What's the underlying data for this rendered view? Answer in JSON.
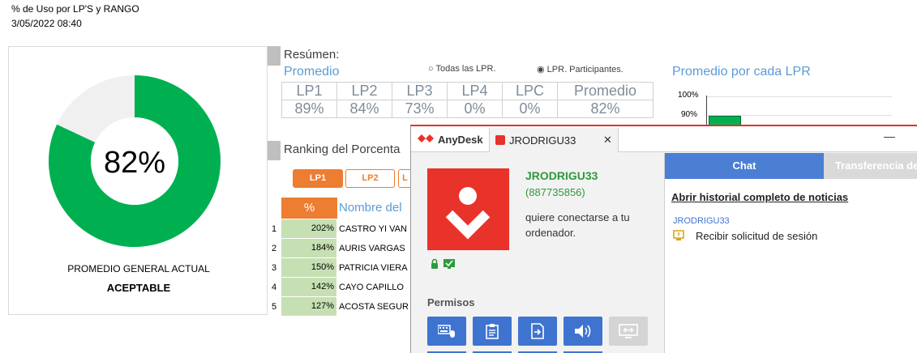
{
  "header": {
    "title": "% de Uso por LP'S y RANGO",
    "date": "3/05/2022 08:40"
  },
  "gauge": {
    "value_pct": 82,
    "value_label": "82%",
    "label": "PROMEDIO GENERAL ACTUAL",
    "status": "ACEPTABLE",
    "colors": {
      "fill": "#00b050",
      "track": "#f0f0f0",
      "border": "#1a7a3a"
    }
  },
  "resumen": {
    "title": "Resúmen:",
    "subtitle": "Promedio",
    "radio_all": "Todas las LPR.",
    "radio_part": "LPR. Participantes.",
    "radio_selected": "participantes",
    "headers": [
      "LP1",
      "LP2",
      "LP3",
      "LP4",
      "LPC",
      "Promedio"
    ],
    "values": [
      "89%",
      "84%",
      "73%",
      "0%",
      "0%",
      "82%"
    ]
  },
  "ranking": {
    "title": "Ranking del Porcenta",
    "buttons": [
      "LP1",
      "LP2",
      "L"
    ],
    "active_button": "LP1",
    "col_pct": "%",
    "col_name": "Nombre del",
    "rows": [
      {
        "idx": "1",
        "pct": "202%",
        "name": "CASTRO YI VAN"
      },
      {
        "idx": "2",
        "pct": "184%",
        "name": "AURIS VARGAS"
      },
      {
        "idx": "3",
        "pct": "150%",
        "name": "PATRICIA VIERA"
      },
      {
        "idx": "4",
        "pct": "142%",
        "name": "CAYO CAPILLO"
      },
      {
        "idx": "5",
        "pct": "127%",
        "name": "ACOSTA SEGUR"
      }
    ]
  },
  "lpr_chart": {
    "title": "Promedio por cada LPR",
    "ticks": [
      "100%",
      "90%"
    ],
    "bar_color": "#00b050"
  },
  "anydesk": {
    "app_name": "AnyDesk",
    "tab_label": "JRODRIGU33",
    "tab_close": "✕",
    "minimize": "—",
    "user_name": "JRODRIGU33",
    "user_id": "(887735856)",
    "message": "quiere conectarse a tu ordenador.",
    "permisos_label": "Permisos",
    "brand_color": "#e8322a",
    "accent_color": "#3e74d0",
    "chat_tab": "Chat",
    "transfer_tab": "Transferencia de",
    "history_link": "Abrir historial completo de noticias",
    "notice_user": "JRODRIGU33",
    "notice_text": "Recibir solicitud de sesión",
    "permission_icons": [
      "keyboard-mouse-icon",
      "clipboard-icon",
      "file-transfer-icon",
      "sound-icon",
      "screen-swap-icon"
    ]
  }
}
